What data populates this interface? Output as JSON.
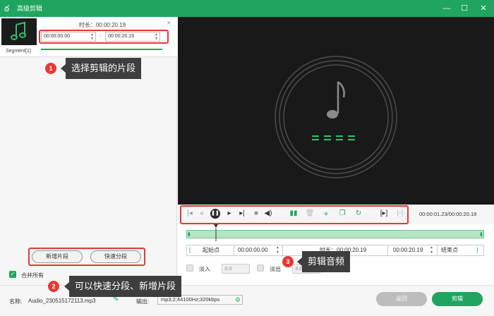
{
  "window": {
    "title": "高级剪辑",
    "controls": [
      "—",
      "☐",
      "✕"
    ]
  },
  "segment": {
    "duration_label": "时长：00:00:20.19",
    "start_time": "00:00:00.00",
    "end_time": "00:00:20.19",
    "separator": "-",
    "tab_label": "Segment[1]"
  },
  "left_actions": {
    "add_segment": "新增片段",
    "quick_split": "快速分段",
    "merge_all": "合并所有"
  },
  "player": {
    "time_readout": "00:00:01.23/00:00:20.19"
  },
  "range": {
    "start_btn": "起始点",
    "start_value": "00:00:00.00",
    "duration": "时长：00:00:20.19",
    "end_value": "00:00:20.19",
    "end_btn": "结束点"
  },
  "fade": {
    "fade_in_label": "淡入",
    "fade_in_value": "3.0",
    "fade_out_label": "淡出",
    "fade_out_value": "3.0"
  },
  "footer": {
    "name_label": "名称:",
    "name_value": "Audio_230515172113.mp3",
    "output_label": "输出:",
    "output_value": "mp3;2;44100Hz;320kbps",
    "back_btn": "返回",
    "cut_btn": "剪辑"
  },
  "annotations": {
    "a1": {
      "number": "1",
      "text": "选择剪辑的片段"
    },
    "a2": {
      "number": "2",
      "text": "可以快速分段、新增片段"
    },
    "a3": {
      "number": "3",
      "text": "剪辑音频"
    }
  },
  "colors": {
    "accent": "#1fa55f",
    "annotation_red": "#e53935",
    "preview_bg": "#191919"
  }
}
